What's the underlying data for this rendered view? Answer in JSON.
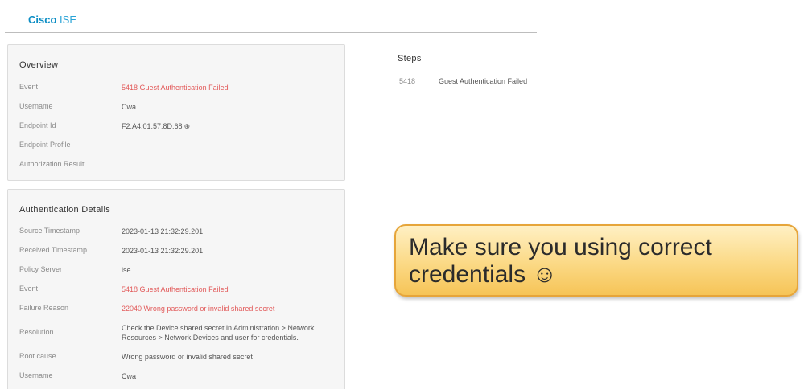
{
  "brand": {
    "name_bold": "Cisco",
    "name_light": "ISE"
  },
  "overview": {
    "title": "Overview",
    "rows": [
      {
        "label": "Event",
        "value": "5418 Guest Authentication Failed"
      },
      {
        "label": "Username",
        "value": "Cwa"
      },
      {
        "label": "Endpoint Id",
        "value": "F2:A4:01:57:8D:68"
      },
      {
        "label": "Endpoint Profile",
        "value": ""
      },
      {
        "label": "Authorization Result",
        "value": ""
      }
    ]
  },
  "auth_details": {
    "title": "Authentication Details",
    "rows": [
      {
        "label": "Source Timestamp",
        "value": "2023-01-13 21:32:29.201"
      },
      {
        "label": "Received Timestamp",
        "value": "2023-01-13 21:32:29.201"
      },
      {
        "label": "Policy Server",
        "value": "ise"
      },
      {
        "label": "Event",
        "value": "5418 Guest Authentication Failed"
      },
      {
        "label": "Failure Reason",
        "value": "22040 Wrong password or invalid shared secret"
      },
      {
        "label": "Resolution",
        "value": "Check the Device shared secret in Administration > Network Resources > Network Devices and user for credentials."
      },
      {
        "label": "Root cause",
        "value": "Wrong password or invalid shared secret"
      },
      {
        "label": "Username",
        "value": "Cwa"
      }
    ]
  },
  "steps": {
    "title": "Steps",
    "items": [
      {
        "code": "5418",
        "description": "Guest Authentication Failed"
      }
    ]
  },
  "callout": {
    "text": "Make sure you using correct credentials ☺"
  },
  "icons": {
    "endpoint_lookup": "globe-icon"
  },
  "colors": {
    "brand": "#0b8dc4",
    "error_text": "#e25a5a",
    "callout_border": "#e6a53a",
    "callout_fill": "#fbd985"
  }
}
